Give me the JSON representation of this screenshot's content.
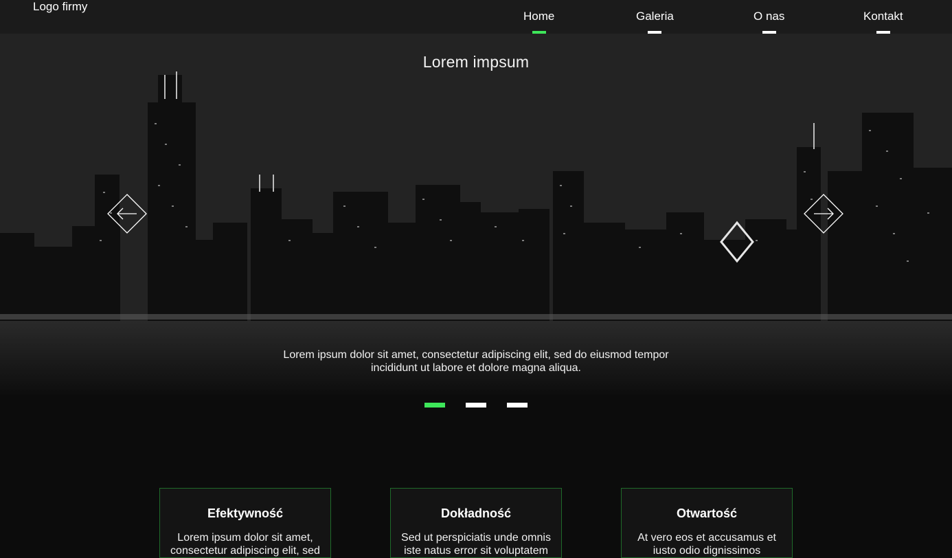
{
  "header": {
    "logo": "Logo firmy",
    "nav": [
      {
        "label": "Home",
        "active": true
      },
      {
        "label": "Galeria",
        "active": false
      },
      {
        "label": "O nas",
        "active": false
      },
      {
        "label": "Kontakt",
        "active": false
      }
    ]
  },
  "hero": {
    "title": "Lorem impsum",
    "text": "Lorem ipsum dolor sit amet, consectetur adipiscing elit, sed do eiusmod tempor incididunt ut labore et dolore magna aliqua.",
    "prev_icon": "arrow-left-diamond-icon",
    "next_icon": "arrow-right-diamond-icon",
    "slides_total": 3,
    "active_slide": 1
  },
  "features": [
    {
      "title": "Efektywność",
      "text": "Lorem ipsum dolor sit amet, consectetur adipiscing elit, sed"
    },
    {
      "title": "Dokładność",
      "text": "Sed ut perspiciatis unde omnis iste natus error sit voluptatem"
    },
    {
      "title": "Otwartość",
      "text": "At vero eos et accusamus et iusto odio dignissimos"
    }
  ],
  "colors": {
    "accent": "#3ee65a",
    "header_bg": "#1b1b1b",
    "page_bg": "#0c0c0c",
    "card_border": "#1f6b2a"
  }
}
